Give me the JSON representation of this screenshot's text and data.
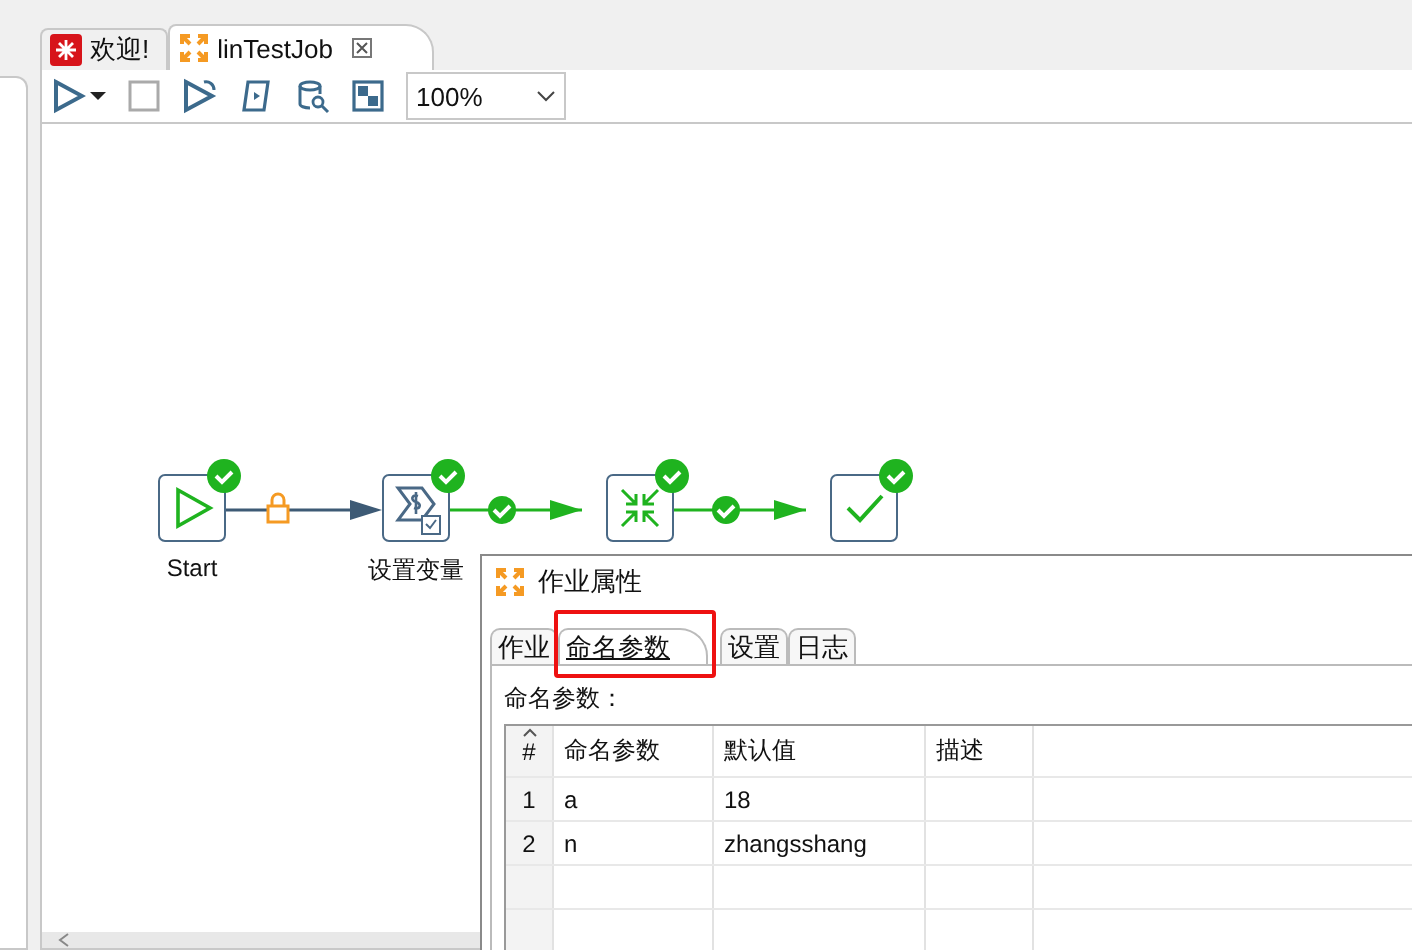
{
  "editor_tabs": [
    {
      "label": "欢迎!",
      "kind": "welcome",
      "selected": false
    },
    {
      "label": "linTestJob",
      "kind": "job",
      "selected": true
    }
  ],
  "toolbar": {
    "zoom": "100%"
  },
  "diagram": {
    "nodes": [
      {
        "label": "Start",
        "kind": "start",
        "ok": true
      },
      {
        "label": "设置变量",
        "kind": "set-variables",
        "ok": true
      },
      {
        "kind": "merge",
        "ok": true
      },
      {
        "kind": "success",
        "ok": true
      }
    ],
    "links": [
      {
        "kind": "locked"
      },
      {
        "kind": "ok"
      },
      {
        "kind": "ok"
      }
    ]
  },
  "dialog": {
    "title": "作业属性",
    "tabs": [
      {
        "label": "作业",
        "selected": false,
        "highlighted": false
      },
      {
        "label": "命名参数",
        "selected": true,
        "highlighted": true
      },
      {
        "label": "设置",
        "selected": false,
        "highlighted": false
      },
      {
        "label": "日志",
        "selected": false,
        "highlighted": false
      }
    ],
    "section_label": "命名参数：",
    "table": {
      "columns": [
        "#",
        "命名参数",
        "默认值",
        "描述"
      ],
      "rows": [
        [
          "1",
          "a",
          "18"
        ],
        [
          "2",
          "n",
          "zhangsshang"
        ]
      ]
    }
  }
}
